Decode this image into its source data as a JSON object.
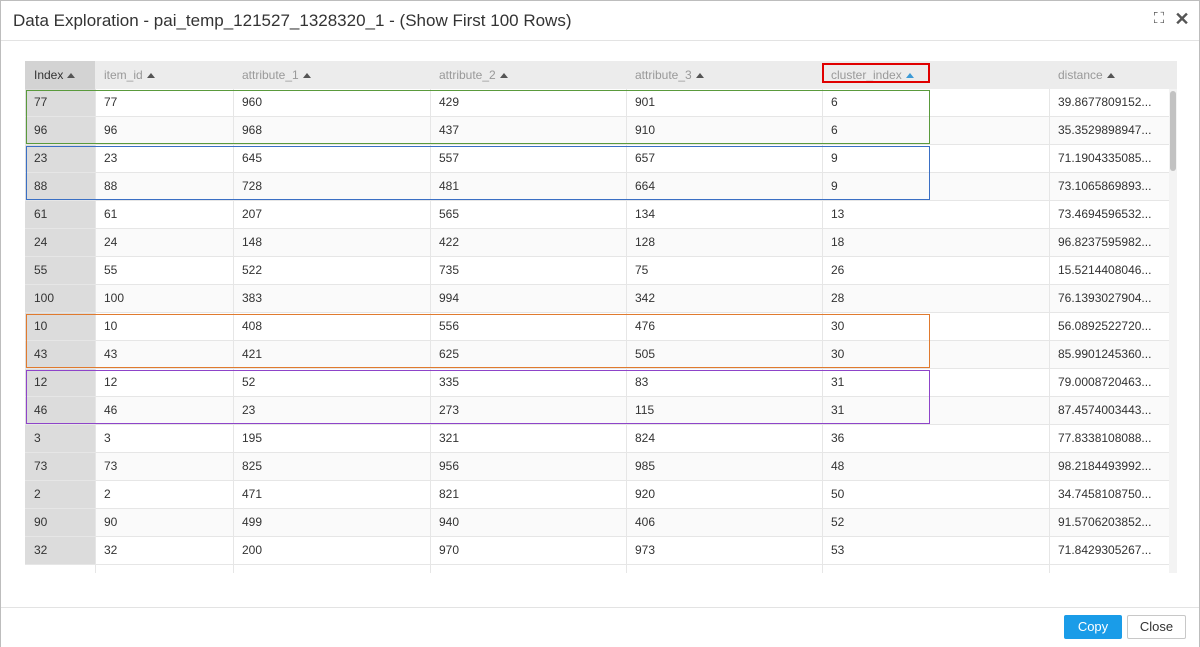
{
  "dialog": {
    "title": "Data Exploration - pai_temp_121527_1328320_1 - (Show First 100 Rows)",
    "icons": [
      "expand-icon",
      "close-icon"
    ],
    "expand_glyph": "⛶",
    "close_glyph": "✕"
  },
  "table": {
    "columns": [
      "Index",
      "item_id",
      "attribute_1",
      "attribute_2",
      "attribute_3",
      "cluster_index",
      "distance"
    ],
    "sorted_column": "cluster_index",
    "rows": [
      [
        "77",
        "77",
        "960",
        "429",
        "901",
        "6",
        "39.8677809152..."
      ],
      [
        "96",
        "96",
        "968",
        "437",
        "910",
        "6",
        "35.3529898947..."
      ],
      [
        "23",
        "23",
        "645",
        "557",
        "657",
        "9",
        "71.1904335085..."
      ],
      [
        "88",
        "88",
        "728",
        "481",
        "664",
        "9",
        "73.1065869893..."
      ],
      [
        "61",
        "61",
        "207",
        "565",
        "134",
        "13",
        "73.4694596532..."
      ],
      [
        "24",
        "24",
        "148",
        "422",
        "128",
        "18",
        "96.8237595982..."
      ],
      [
        "55",
        "55",
        "522",
        "735",
        "75",
        "26",
        "15.5214408046..."
      ],
      [
        "100",
        "100",
        "383",
        "994",
        "342",
        "28",
        "76.1393027904..."
      ],
      [
        "10",
        "10",
        "408",
        "556",
        "476",
        "30",
        "56.0892522720..."
      ],
      [
        "43",
        "43",
        "421",
        "625",
        "505",
        "30",
        "85.9901245360..."
      ],
      [
        "12",
        "12",
        "52",
        "335",
        "83",
        "31",
        "79.0008720463..."
      ],
      [
        "46",
        "46",
        "23",
        "273",
        "115",
        "31",
        "87.4574003443..."
      ],
      [
        "3",
        "3",
        "195",
        "321",
        "824",
        "36",
        "77.8338108088..."
      ],
      [
        "73",
        "73",
        "825",
        "956",
        "985",
        "48",
        "98.2184493992..."
      ],
      [
        "2",
        "2",
        "471",
        "821",
        "920",
        "50",
        "34.7458108750..."
      ],
      [
        "90",
        "90",
        "499",
        "940",
        "406",
        "52",
        "91.5706203852..."
      ],
      [
        "32",
        "32",
        "200",
        "970",
        "973",
        "53",
        "71.8429305267..."
      ]
    ],
    "highlight_groups": [
      {
        "cluster": "6",
        "color": "#5a9a3c"
      },
      {
        "cluster": "9",
        "color": "#3a6fc4"
      },
      {
        "cluster": "30",
        "color": "#e07a2e"
      },
      {
        "cluster": "31",
        "color": "#8e44c9"
      }
    ],
    "sort_highlight_color": "#e00000"
  },
  "footer": {
    "copy_label": "Copy",
    "close_label": "Close"
  }
}
